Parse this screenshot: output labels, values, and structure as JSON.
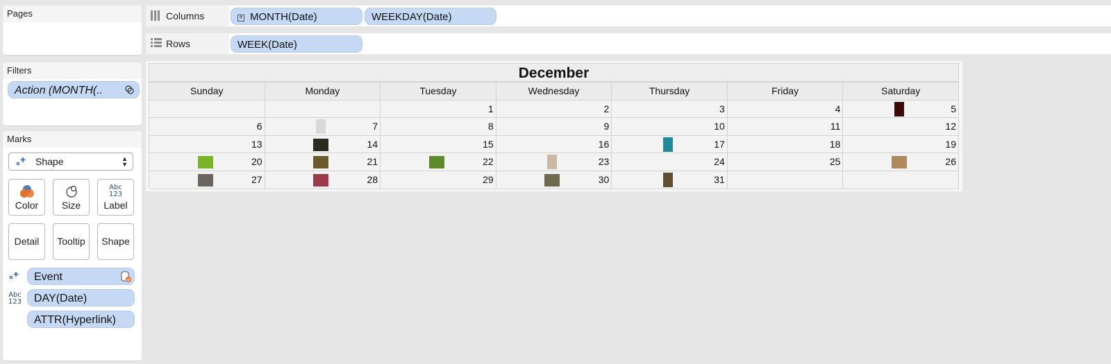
{
  "pages": {
    "title": "Pages"
  },
  "filters": {
    "title": "Filters",
    "pill": "Action (MONTH(.."
  },
  "marks": {
    "title": "Marks",
    "mark_type": "Shape",
    "buttons": {
      "color": "Color",
      "size": "Size",
      "label": "Label",
      "detail": "Detail",
      "tooltip": "Tooltip",
      "shape": "Shape"
    },
    "fields": [
      "Event",
      "DAY(Date)",
      "ATTR(Hyperlink)"
    ]
  },
  "columns_shelf": {
    "label": "Columns",
    "pills": [
      "MONTH(Date)",
      "WEEKDAY(Date)"
    ]
  },
  "rows_shelf": {
    "label": "Rows",
    "pills": [
      "WEEK(Date)"
    ]
  },
  "calendar": {
    "month": "December",
    "weekdays": [
      "Sunday",
      "Monday",
      "Tuesday",
      "Wednesday",
      "Thursday",
      "Friday",
      "Saturday"
    ],
    "weeks": [
      [
        "",
        "",
        "1",
        "2",
        "3",
        "4",
        "5"
      ],
      [
        "6",
        "7",
        "8",
        "9",
        "10",
        "11",
        "12"
      ],
      [
        "13",
        "14",
        "15",
        "16",
        "17",
        "18",
        "19"
      ],
      [
        "20",
        "21",
        "22",
        "23",
        "24",
        "25",
        "26"
      ],
      [
        "27",
        "28",
        "29",
        "30",
        "31",
        "",
        ""
      ]
    ],
    "event_thumbnails": [
      {
        "day": "5",
        "color": "#3a0a0a"
      },
      {
        "day": "7",
        "color": "#d9d9d9"
      },
      {
        "day": "14",
        "color": "#2b2b1e"
      },
      {
        "day": "17",
        "color": "#1f8a9a"
      },
      {
        "day": "20",
        "color": "#79b52a"
      },
      {
        "day": "21",
        "color": "#6b5a2a"
      },
      {
        "day": "22",
        "color": "#5c8a2c"
      },
      {
        "day": "23",
        "color": "#c9b8a6"
      },
      {
        "day": "26",
        "color": "#b08a5a"
      },
      {
        "day": "27",
        "color": "#6a6560"
      },
      {
        "day": "28",
        "color": "#9b3a4a"
      },
      {
        "day": "30",
        "color": "#6d6a50"
      },
      {
        "day": "31",
        "color": "#5e4e34"
      }
    ]
  },
  "colors": {
    "pill_bg": "#c6d9f4",
    "canvas_bg": "#e6e6e6",
    "panel_bg": "#ffffff",
    "color_icon_orange": "#e8722c",
    "color_icon_blue": "#4f7fb5"
  },
  "icons": {
    "columns": "columns-icon",
    "rows": "rows-icon",
    "filter_action": "linked-filter-icon",
    "shape_mark": "shape-mark-icon",
    "database": "database-check-icon"
  }
}
